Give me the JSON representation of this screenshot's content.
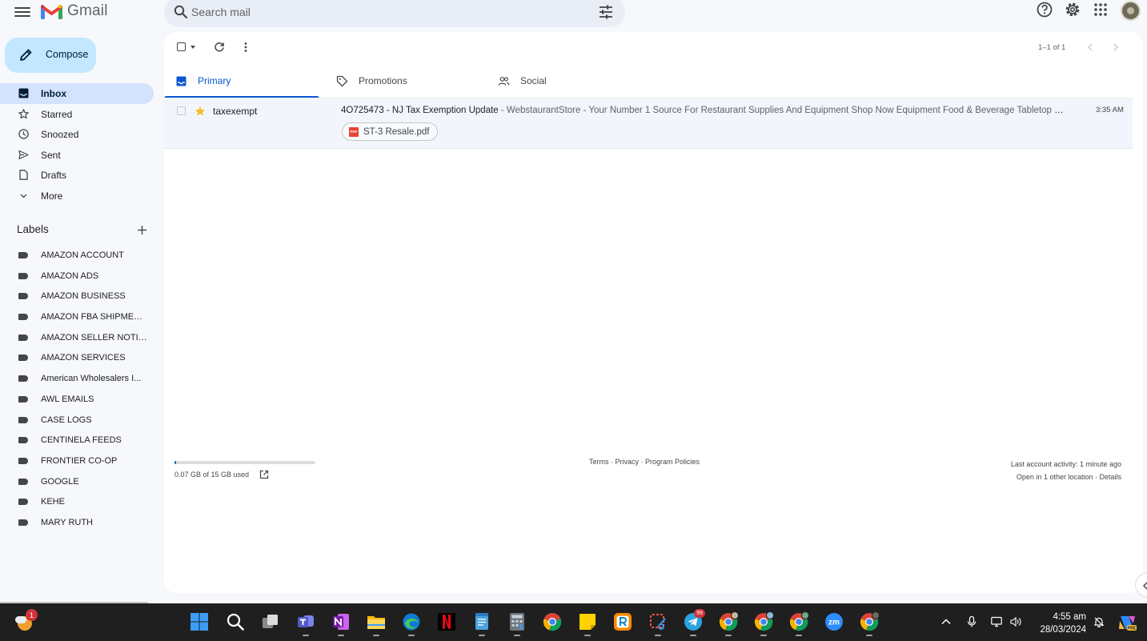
{
  "app": {
    "name": "Gmail"
  },
  "search": {
    "placeholder": "Search mail"
  },
  "compose": {
    "label": "Compose"
  },
  "nav": {
    "items": [
      {
        "label": "Inbox",
        "icon": "inbox-icon",
        "active": true
      },
      {
        "label": "Starred",
        "icon": "star-icon"
      },
      {
        "label": "Snoozed",
        "icon": "clock-icon"
      },
      {
        "label": "Sent",
        "icon": "send-icon"
      },
      {
        "label": "Drafts",
        "icon": "draft-icon"
      },
      {
        "label": "More",
        "icon": "chevron-down-icon"
      }
    ]
  },
  "labels": {
    "title": "Labels",
    "items": [
      "AMAZON ACCOUNT",
      "AMAZON ADS",
      "AMAZON BUSINESS",
      "AMAZON FBA SHIPMEN...",
      "AMAZON SELLER NOTIF...",
      "AMAZON SERVICES",
      "American Wholesalers I...",
      "AWL EMAILS",
      "CASE LOGS",
      "CENTINELA FEEDS",
      "FRONTIER CO-OP",
      "GOOGLE",
      "KEHE",
      "MARY RUTH"
    ]
  },
  "toolbar": {
    "pager": "1–1 of 1"
  },
  "tabs": [
    {
      "label": "Primary",
      "icon": "inbox-icon",
      "active": true
    },
    {
      "label": "Promotions",
      "icon": "tag-icon"
    },
    {
      "label": "Social",
      "icon": "people-icon"
    }
  ],
  "emails": [
    {
      "sender": "taxexempt",
      "subject": "4O725473 - NJ Tax Exemption Update",
      "snippet": " - WebstaurantStore - Your Number 1 Source For Restaurant Supplies And Equipment Shop Now Equipment Food & Beverage Tabletop Disp...",
      "time": "3:35 AM",
      "starred": true,
      "attachment": "ST-3 Resale.pdf"
    }
  ],
  "footer": {
    "storage": "0.07 GB of 15 GB used",
    "storage_fraction": 0.005,
    "links": "Terms · Privacy · Program Policies",
    "activity": "Last account activity: 1 minute ago",
    "other_location": "Open in 1 other location · ",
    "details": "Details"
  },
  "taskbar": {
    "weather_badge": "1",
    "telegram_badge": "99",
    "time": "4:55 am",
    "date": "28/03/2024"
  },
  "colors": {
    "accent": "#0b57d0",
    "compose_bg": "#c2e7ff",
    "active_nav": "#d3e3fd",
    "background": "#f6f8fc"
  }
}
